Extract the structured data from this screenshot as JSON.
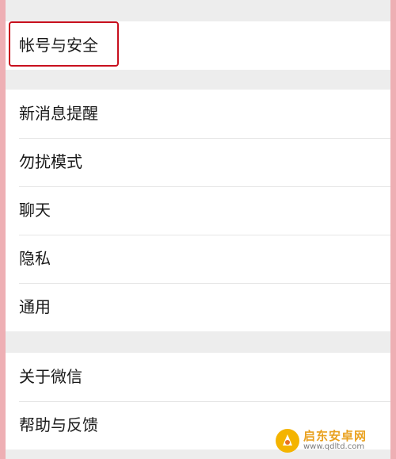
{
  "settings": {
    "group1": [
      "帐号与安全"
    ],
    "group2": [
      "新消息提醒",
      "勿扰模式",
      "聊天",
      "隐私",
      "通用"
    ],
    "group3": [
      "关于微信",
      "帮助与反馈"
    ]
  },
  "watermark": {
    "title": "启东安卓网",
    "url": "www.qdltd.com"
  },
  "colors": {
    "highlight": "#c8101e",
    "frame": "#eeafb4",
    "background": "#ededed"
  }
}
